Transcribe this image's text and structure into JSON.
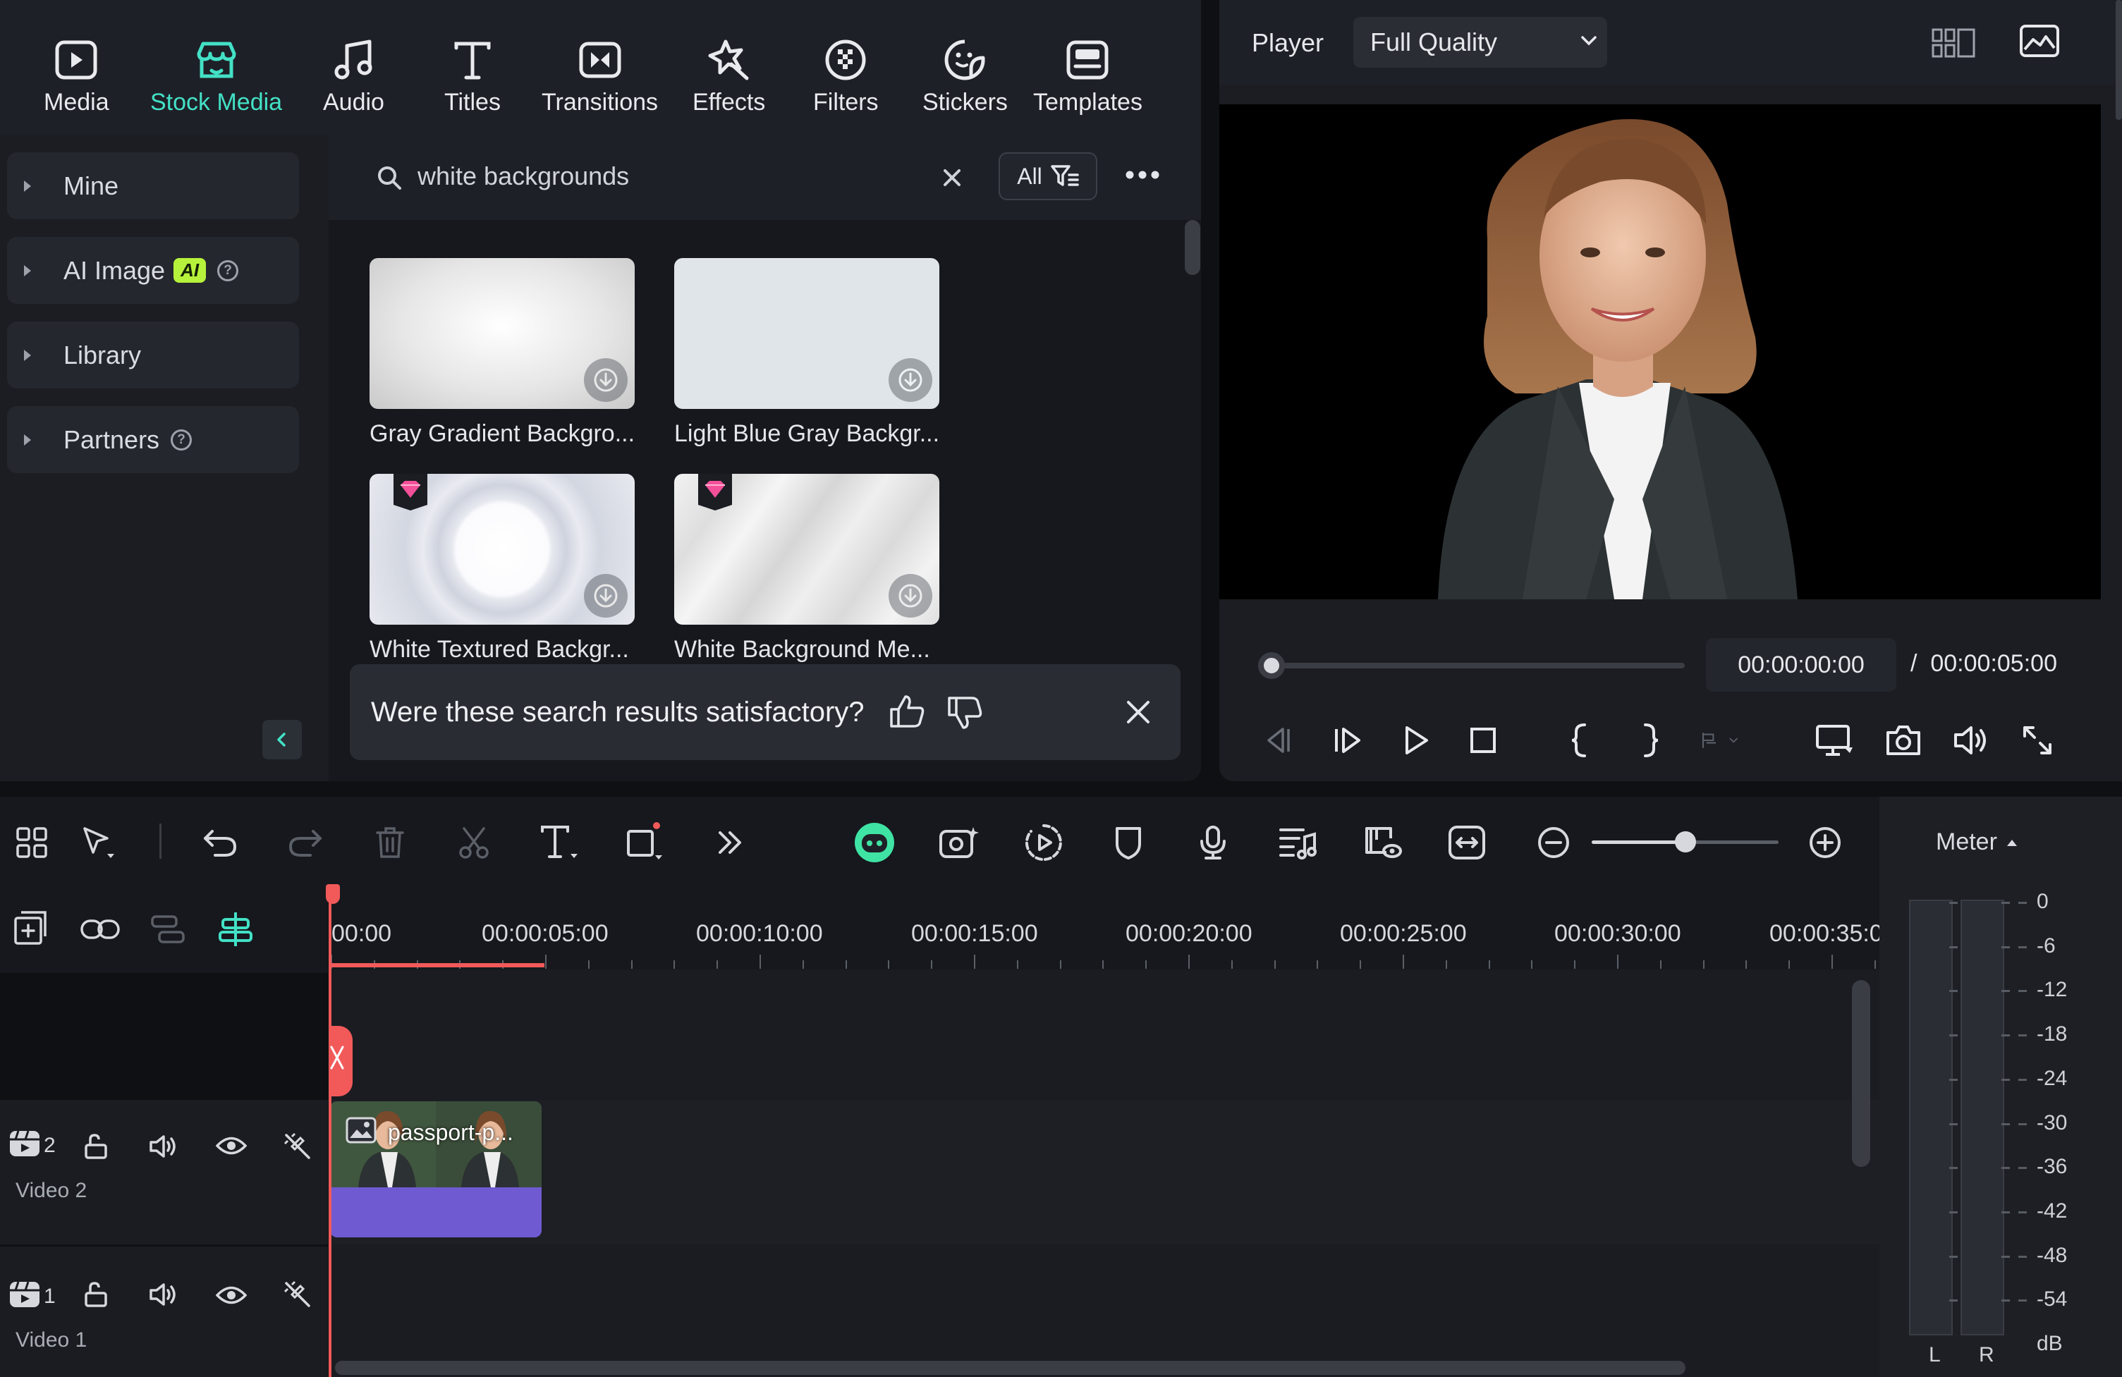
{
  "tabs": [
    {
      "label": "Media",
      "icon": "media-icon",
      "active": false
    },
    {
      "label": "Stock Media",
      "icon": "stock-media-icon",
      "active": true
    },
    {
      "label": "Audio",
      "icon": "music-note-icon",
      "active": false
    },
    {
      "label": "Titles",
      "icon": "titles-icon",
      "active": false
    },
    {
      "label": "Transitions",
      "icon": "transitions-icon",
      "active": false
    },
    {
      "label": "Effects",
      "icon": "effects-icon",
      "active": false
    },
    {
      "label": "Filters",
      "icon": "filters-icon",
      "active": false
    },
    {
      "label": "Stickers",
      "icon": "stickers-icon",
      "active": false
    },
    {
      "label": "Templates",
      "icon": "templates-icon",
      "active": false
    }
  ],
  "sidebar": {
    "items": [
      {
        "label": "Mine"
      },
      {
        "label": "AI Image",
        "badge": "AI"
      },
      {
        "label": "Library"
      },
      {
        "label": "Partners"
      }
    ]
  },
  "search": {
    "value": "white backgrounds",
    "filter_label": "All"
  },
  "results": [
    {
      "caption": "Gray Gradient Backgro...",
      "premium": false
    },
    {
      "caption": "Light Blue Gray Backgr...",
      "premium": false
    },
    {
      "caption": "White Textured Backgr...",
      "premium": true
    },
    {
      "caption": "White Background Me...",
      "premium": true
    }
  ],
  "feedback": {
    "question": "Were these search results satisfactory?"
  },
  "player": {
    "label": "Player",
    "quality": "Full Quality",
    "current_time": "00:00:00:00",
    "separator": "/",
    "total_time": "00:00:05:00",
    "progress": 0
  },
  "timeline": {
    "ruler": [
      "00:00",
      "00:00:05:00",
      "00:00:10:00",
      "00:00:15:00",
      "00:00:20:00",
      "00:00:25:00",
      "00:00:30:00",
      "00:00:35:0"
    ],
    "tracks": [
      {
        "number": "2",
        "name": "Video 2"
      },
      {
        "number": "1",
        "name": "Video 1"
      }
    ],
    "clip": {
      "name": "passport-p..."
    },
    "zoom_level": 0.5
  },
  "meter": {
    "label": "Meter",
    "scale": [
      "0",
      "-6",
      "-12",
      "-18",
      "-24",
      "-30",
      "-36",
      "-42",
      "-48",
      "-54",
      "dB"
    ],
    "channels": [
      "L",
      "R"
    ]
  },
  "colors": {
    "accent": "#43e1c6",
    "playhead": "#f25a5a",
    "clip": "#6f5ad1",
    "ai_badge": "#b6f23b"
  }
}
